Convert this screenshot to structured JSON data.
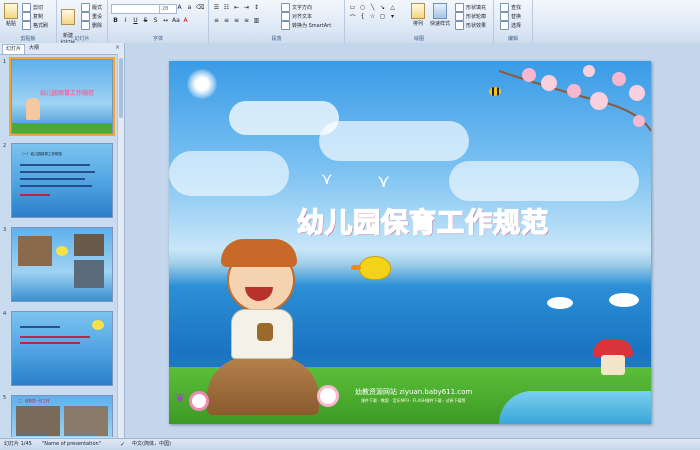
{
  "ribbon": {
    "clipboard": {
      "paste": "粘贴",
      "cut": "剪切",
      "copy": "复制",
      "format_painter": "格式刷",
      "label": "剪贴板"
    },
    "slides": {
      "new_slide": "新建\n幻灯片",
      "layout": "版式",
      "reset": "重设",
      "delete": "删除",
      "label": "幻灯片"
    },
    "font": {
      "name": "",
      "size": "28",
      "label": "字体"
    },
    "paragraph": {
      "text_direction": "文字方向",
      "align_text": "对齐文本",
      "smartart": "转换为 SmartArt",
      "label": "段落"
    },
    "drawing": {
      "arrange": "排列",
      "quick_styles": "快速样式",
      "shape_fill": "形状填充",
      "shape_outline": "形状轮廓",
      "shape_effects": "形状效果",
      "label": "绘图"
    },
    "editing": {
      "find": "查找",
      "replace": "替换",
      "select": "选择",
      "label": "编辑"
    }
  },
  "pane": {
    "tabs": [
      "幻灯片",
      "大纲"
    ],
    "thumbnails": [
      {
        "num": "1",
        "title": "幼儿园保育工作规范"
      },
      {
        "num": "2",
        "title": "（一）幼儿园保育工作规范"
      },
      {
        "num": "3",
        "title": ""
      },
      {
        "num": "4",
        "title": ""
      },
      {
        "num": "5",
        "title": "二、保育员一日工作"
      }
    ]
  },
  "slide": {
    "title": "幼儿园保育工作规范",
    "site_line": "幼教资源网站  ziyuan.baby611.com",
    "site_sub": "课件下载 · 教案 · 音乐MP3 · FLASH课件下载 · 试卷下载等"
  },
  "status": {
    "slide_pos": "幻灯片 1/45",
    "theme": "\"Name of presentation\"",
    "language": "中文(简体，中国)"
  },
  "colors": {
    "title_pink": "#f06a9c",
    "ribbon_blue": "#dce7f4",
    "selection": "#f0a830"
  }
}
